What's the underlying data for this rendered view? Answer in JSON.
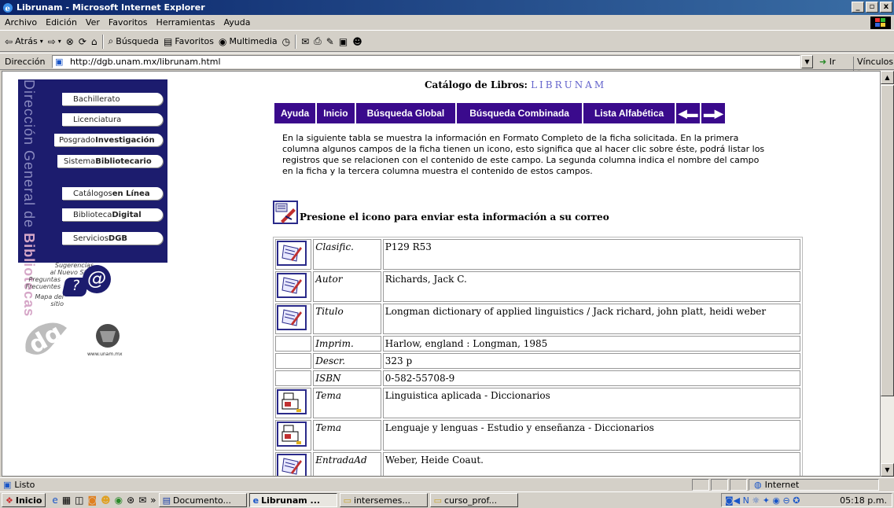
{
  "window": {
    "title": "Librunam - Microsoft Internet Explorer",
    "buttons": [
      "_",
      "▫",
      "x"
    ]
  },
  "menu": [
    "Archivo",
    "Edición",
    "Ver",
    "Favoritos",
    "Herramientas",
    "Ayuda"
  ],
  "toolbar": {
    "back": "Atrás",
    "search": "Búsqueda",
    "favorites": "Favoritos",
    "multimedia": "Multimedia"
  },
  "address": {
    "label": "Dirección",
    "url": "http://dgb.unam.mx/librunam.html",
    "go": "Ir",
    "links": "Vínculos"
  },
  "sidebar": {
    "vertical_text": "Dirección General de",
    "vertical_highlight": "Bibliotecas",
    "items": [
      {
        "light": "Bachillerato",
        "bold": ""
      },
      {
        "light": "Licenciatura",
        "bold": ""
      },
      {
        "light": "Posgrado",
        "bold": "Investigación"
      },
      {
        "light": "Sistema",
        "bold": "Bibliotecario"
      },
      {
        "light": "Catálogos",
        "bold": "en Línea"
      },
      {
        "light": "Biblioteca",
        "bold": "Digital"
      },
      {
        "light": "Servicios",
        "bold": "DGB"
      }
    ],
    "suggestions": [
      "Sugerencias al Nuevo Sitio",
      "Preguntas Frecuentes",
      "Mapa del sitio"
    ],
    "unam_url": "www.unam.mx"
  },
  "heading": {
    "prefix": "Catálogo de Libros:",
    "name": "LIBRUNAM"
  },
  "nav": [
    "Ayuda",
    "Inicio",
    "Búsqueda Global",
    "Búsqueda Combinada",
    "Lista Alfabética"
  ],
  "intro": "En la siguiente tabla se muestra la información en Formato Completo de la ficha solicitada. En la primera columna algunos campos de la ficha tienen un icono, esto significa que al hacer clic sobre éste, podrá listar los registros que se relacionen con el contenido de este campo. La segunda columna indica el nombre del campo en la ficha y la tercera columna muestra el contenido de estos campos.",
  "mail_text": "Presione el icono para enviar esta información a su correo",
  "records": [
    {
      "icon": "notebook-icon",
      "field": "Clasific.",
      "value": "P129 R53"
    },
    {
      "icon": "notebook-icon",
      "field": "Autor",
      "value": "Richards, Jack C."
    },
    {
      "icon": "notebook-icon",
      "field": "Titulo",
      "value": "Longman dictionary of applied linguistics / Jack richard, john platt, heidi weber"
    },
    {
      "icon": "",
      "field": "Imprim.",
      "value": "Harlow, england : Longman, 1985"
    },
    {
      "icon": "",
      "field": "Descr.",
      "value": "323 p"
    },
    {
      "icon": "",
      "field": "ISBN",
      "value": "0-582-55708-9"
    },
    {
      "icon": "topic-icon",
      "field": "Tema",
      "value": "Linguistica aplicada - Diccionarios"
    },
    {
      "icon": "topic-icon",
      "field": "Tema",
      "value": "Lenguaje y lenguas - Estudio y enseñanza - Diccionarios"
    },
    {
      "icon": "notebook-icon",
      "field": "EntradaAd",
      "value": "Weber, Heide Coaut."
    }
  ],
  "status": {
    "text": "Listo",
    "zone": "Internet"
  },
  "taskbar": {
    "start": "Inicio",
    "tasks": [
      "Documento...",
      "Librunam ...",
      "intersemes...",
      "curso_prof..."
    ],
    "clock": "05:18 p.m."
  }
}
